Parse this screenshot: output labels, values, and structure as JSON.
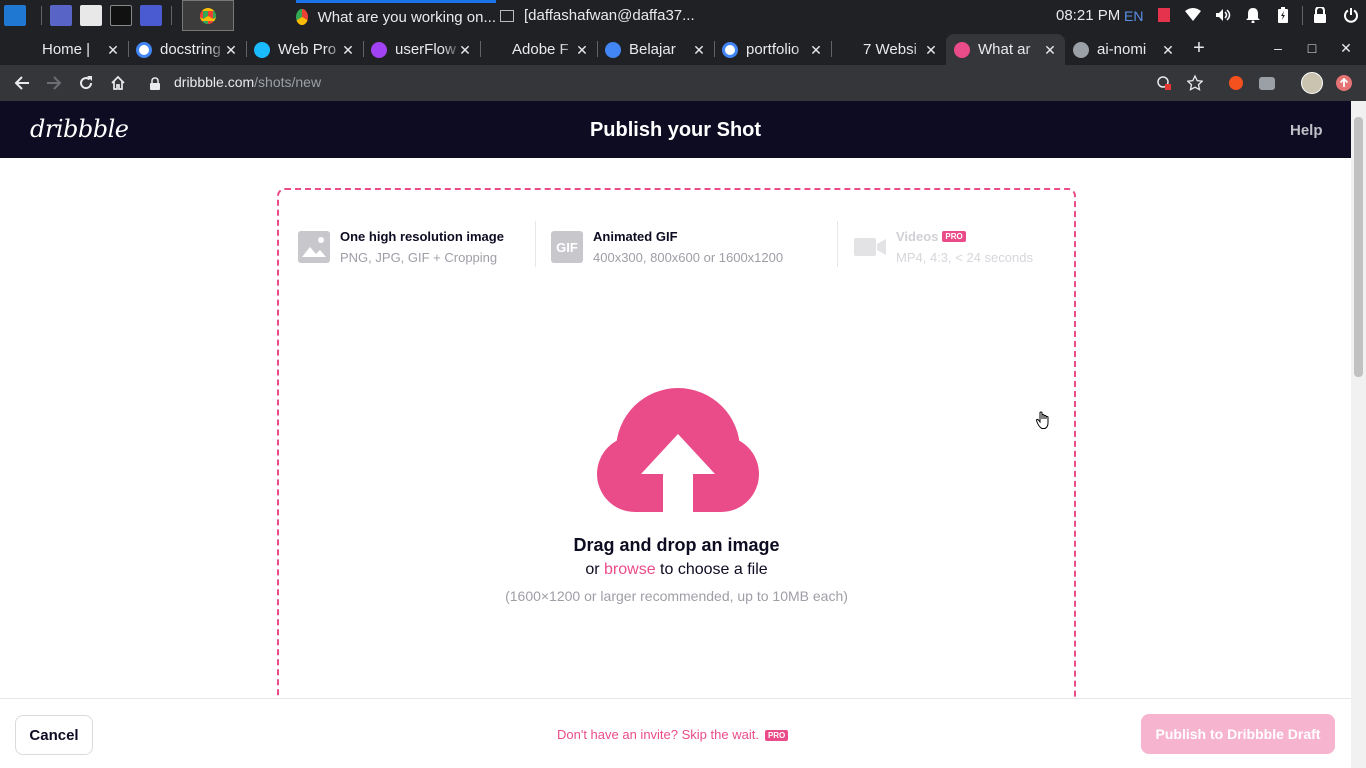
{
  "taskbar": {
    "active_window_title": "What are you working on...",
    "terminal_window_title": "[daffashafwan@daffa37...",
    "clock": "08:21 PM",
    "keyboard_layout": "EN"
  },
  "tabs": [
    {
      "title": "Home | ",
      "favicon": "g-icon",
      "color": "#202124"
    },
    {
      "title": "docstring",
      "favicon": "google-icon",
      "color": "#ffffff"
    },
    {
      "title": "Web Pro",
      "favicon": "figma-icon",
      "color": "#1abcfe"
    },
    {
      "title": "userFlow",
      "favicon": "m-icon",
      "color": "#a142f4"
    },
    {
      "title": "Adobe F",
      "favicon": "pf-icon",
      "color": "#202124"
    },
    {
      "title": "Belajar",
      "favicon": "belajar-icon",
      "color": "#4285f4"
    },
    {
      "title": "portfolio",
      "favicon": "google-icon",
      "color": "#ffffff"
    },
    {
      "title": "7 Websi",
      "favicon": "ux-icon",
      "color": "#202124"
    },
    {
      "title": "What ar",
      "favicon": "dribbble-icon",
      "color": "#ea4c89",
      "active": true
    },
    {
      "title": "ai-nomi",
      "favicon": "globe-icon",
      "color": "#9aa0a6"
    }
  ],
  "omnibox": {
    "domain": "dribbble.com",
    "path": "/shots/new"
  },
  "header": {
    "logo": "dribbble",
    "title": "Publish your Shot",
    "help": "Help"
  },
  "options": [
    {
      "title": "One high resolution image",
      "subtitle": "PNG, JPG, GIF + Cropping",
      "icon": "image-icon"
    },
    {
      "title": "Animated GIF",
      "subtitle": "400x300, 800x600 or 1600x1200",
      "icon": "gif-icon",
      "icon_text": "GIF"
    },
    {
      "title": "Videos",
      "subtitle": "MP4, 4:3, < 24 seconds",
      "icon": "video-icon",
      "badge": "PRO",
      "disabled": true
    }
  ],
  "dropzone": {
    "title": "Drag and drop an image",
    "or": "or",
    "browse": "browse",
    "choose": "to choose a file",
    "hint": "(1600×1200 or larger recommended, up to 10MB each)",
    "icon": "cloud-upload-icon"
  },
  "footer": {
    "cancel": "Cancel",
    "invite": "Don't have an invite? Skip the wait.",
    "invite_badge": "PRO",
    "publish": "Publish to Dribbble Draft"
  },
  "colors": {
    "brand_pink": "#ea4c89",
    "header_bg": "#0d0c22",
    "publish_disabled": "#f7b4cf"
  }
}
